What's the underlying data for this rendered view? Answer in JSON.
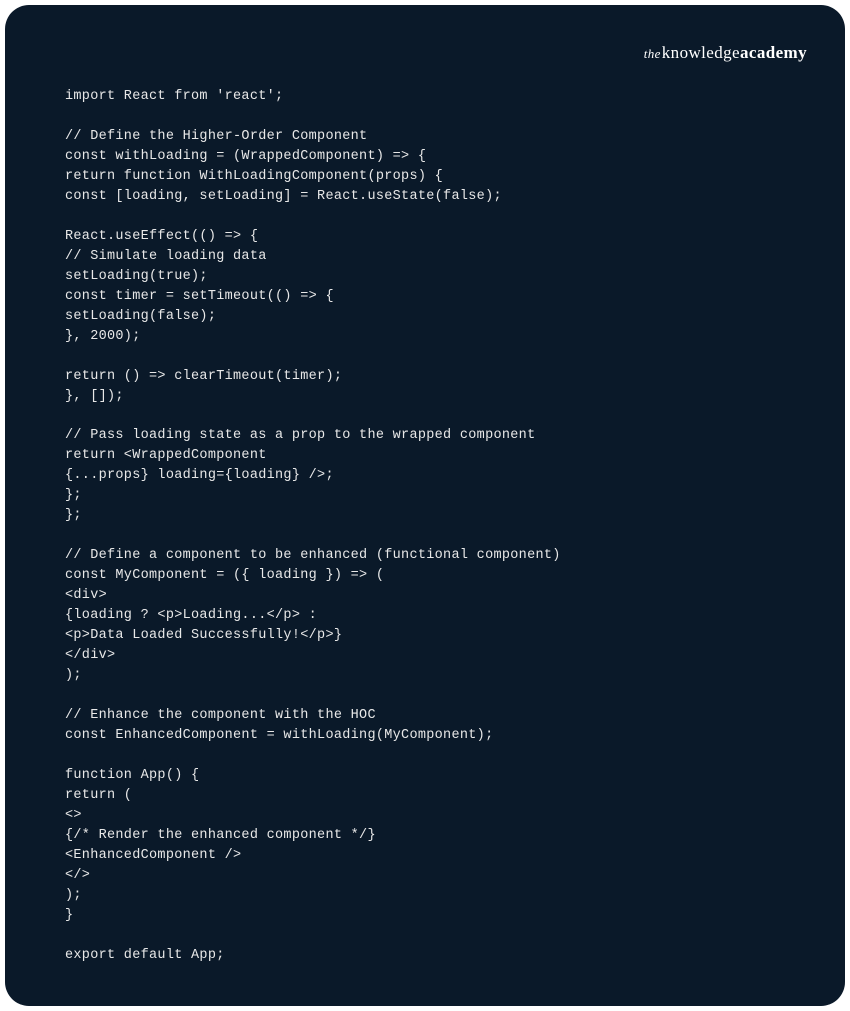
{
  "brand": {
    "the": "the",
    "knowledge": "knowledge",
    "academy": "academy"
  },
  "code": {
    "lines": "import React from 'react';\n\n// Define the Higher-Order Component\nconst withLoading = (WrappedComponent) => {\nreturn function WithLoadingComponent(props) {\nconst [loading, setLoading] = React.useState(false);\n\nReact.useEffect(() => {\n// Simulate loading data\nsetLoading(true);\nconst timer = setTimeout(() => {\nsetLoading(false);\n}, 2000);\n\nreturn () => clearTimeout(timer);\n}, []);\n\n// Pass loading state as a prop to the wrapped component\nreturn <WrappedComponent\n{...props} loading={loading} />;\n};\n};\n\n// Define a component to be enhanced (functional component)\nconst MyComponent = ({ loading }) => (\n<div>\n{loading ? <p>Loading...</p> :\n<p>Data Loaded Successfully!</p>}\n</div>\n);\n\n// Enhance the component with the HOC\nconst EnhancedComponent = withLoading(MyComponent);\n\nfunction App() {\nreturn (\n<>\n{/* Render the enhanced component */}\n<EnhancedComponent />\n</>\n);\n}\n\nexport default App;"
  }
}
